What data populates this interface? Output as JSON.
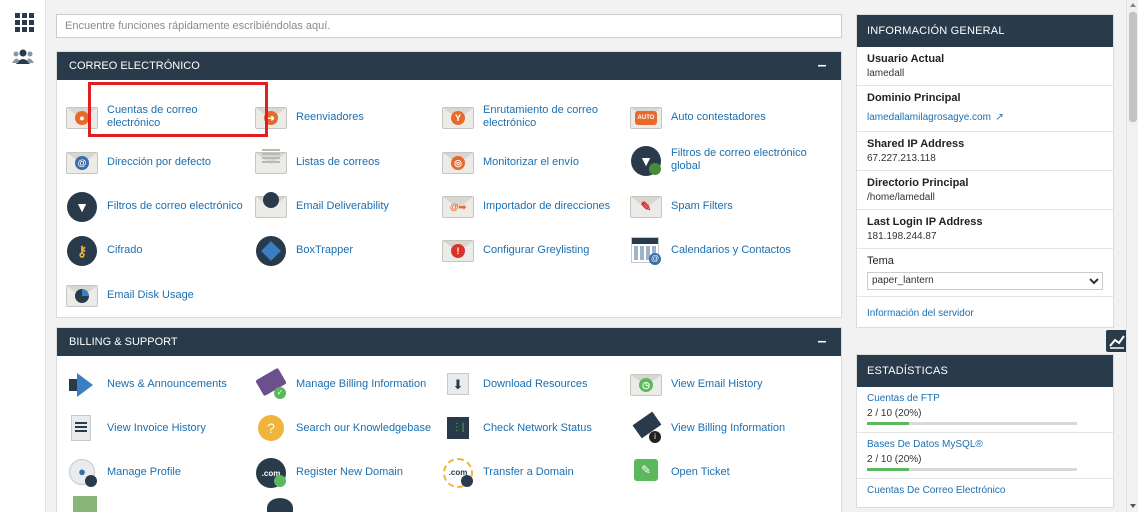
{
  "search": {
    "placeholder": "Encuentre funciones rápidamente escribiéndolas aquí."
  },
  "email_panel": {
    "title": "CORREO ELECTRÓNICO",
    "collapse": "–",
    "items": [
      {
        "label": "Cuentas de correo electrónico",
        "icon": "user-envelope-icon"
      },
      {
        "label": "Reenviadores",
        "icon": "forward-envelope-icon"
      },
      {
        "label": "Enrutamiento de correo electrónico",
        "icon": "routing-envelope-icon"
      },
      {
        "label": "Auto contestadores",
        "icon": "autoresponder-envelope-icon",
        "badge": "AUTO"
      },
      {
        "label": "Dirección por defecto",
        "icon": "at-envelope-icon",
        "badge": "@"
      },
      {
        "label": "Listas de correos",
        "icon": "mailing-list-icon"
      },
      {
        "label": "Monitorizar el envío",
        "icon": "track-delivery-icon"
      },
      {
        "label": "Filtros de correo electrónico global",
        "icon": "global-filter-icon"
      },
      {
        "label": "Filtros de correo electrónico",
        "icon": "filter-icon"
      },
      {
        "label": "Email Deliverability",
        "icon": "deliverability-icon"
      },
      {
        "label": "Importador de direcciones",
        "icon": "address-importer-icon",
        "badge": "@➡"
      },
      {
        "label": "Spam Filters",
        "icon": "spam-filter-icon"
      },
      {
        "label": "Cifrado",
        "icon": "encryption-key-icon"
      },
      {
        "label": "BoxTrapper",
        "icon": "boxtrapper-icon"
      },
      {
        "label": "Configurar Greylisting",
        "icon": "greylisting-icon",
        "badge": "!"
      },
      {
        "label": "Calendarios y Contactos",
        "icon": "calendar-contacts-icon"
      },
      {
        "label": "Email Disk Usage",
        "icon": "disk-usage-icon"
      }
    ]
  },
  "billing_panel": {
    "title": "BILLING & SUPPORT",
    "collapse": "–",
    "items": [
      {
        "label": "News & Announcements",
        "icon": "megaphone-icon"
      },
      {
        "label": "Manage Billing Information",
        "icon": "credit-card-icon"
      },
      {
        "label": "Download Resources",
        "icon": "download-icon"
      },
      {
        "label": "View Email History",
        "icon": "email-history-icon"
      },
      {
        "label": "View Invoice History",
        "icon": "invoice-icon"
      },
      {
        "label": "Search our Knowledgebase",
        "icon": "knowledgebase-bulb-icon"
      },
      {
        "label": "Check Network Status",
        "icon": "network-status-icon"
      },
      {
        "label": "View Billing Information",
        "icon": "billing-info-icon"
      },
      {
        "label": "Manage Profile",
        "icon": "profile-icon"
      },
      {
        "label": "Register New Domain",
        "icon": "register-domain-icon",
        "badge": ".com"
      },
      {
        "label": "Transfer a Domain",
        "icon": "transfer-domain-icon",
        "badge": ".com"
      },
      {
        "label": "Open Ticket",
        "icon": "open-ticket-icon"
      }
    ]
  },
  "general_info": {
    "title": "INFORMACIÓN GENERAL",
    "current_user_label": "Usuario Actual",
    "current_user": "lamedall",
    "main_domain_label": "Dominio Principal",
    "main_domain": "lamedallamilagrosagye.com",
    "shared_ip_label": "Shared IP Address",
    "shared_ip": "67.227.213.118",
    "home_dir_label": "Directorio Principal",
    "home_dir": "/home/lamedall",
    "last_login_label": "Last Login IP Address",
    "last_login": "181.198.244.87",
    "theme_label": "Tema",
    "theme_value": "paper_lantern",
    "server_info_link": "Información del servidor"
  },
  "stats": {
    "title": "ESTADÍSTICAS",
    "items": [
      {
        "label": "Cuentas de FTP",
        "value": "2 / 10  (20%)",
        "percent": 20
      },
      {
        "label": "Bases De Datos MySQL®",
        "value": "2 / 10  (20%)",
        "percent": 20
      },
      {
        "label": "Cuentas De Correo Electrónico"
      }
    ]
  }
}
